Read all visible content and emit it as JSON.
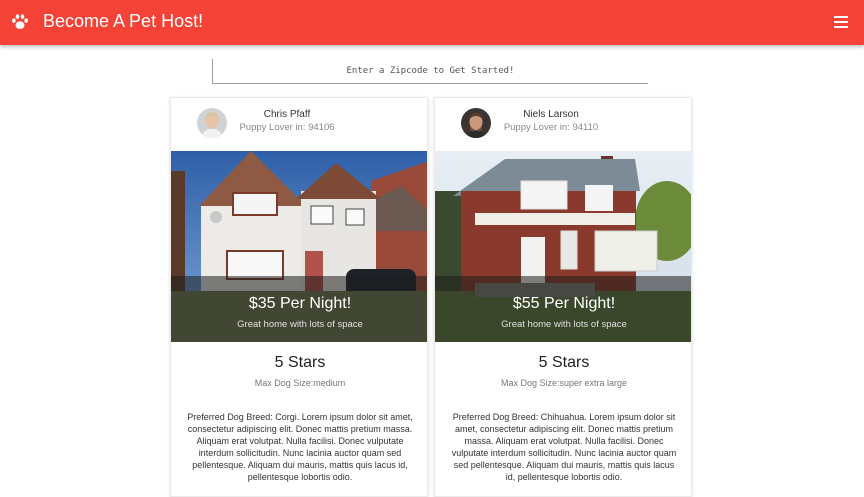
{
  "app": {
    "title": "Become A Pet Host!",
    "brand_color": "#f44336",
    "logo_icon": "paw-icon",
    "menu_icon": "hamburger-menu-icon"
  },
  "search": {
    "placeholder": "Enter a Zipcode to Get Started!",
    "value": ""
  },
  "listings": [
    {
      "host_name": "Chris Pfaff",
      "host_zip": "Puppy Lover in: 94106",
      "price": "$35 Per Night!",
      "tagline": "Great home with lots of space",
      "rating": "5 Stars",
      "max_dog_size": "Max Dog Size:medium",
      "description": "Preferred Dog Breed: Corgi. Lorem ipsum dolor sit amet, consectetur adipiscing elit. Donec mattis pretium massa. Aliquam erat volutpat. Nulla facilisi. Donec vulputate interdum sollicitudin. Nunc lacinia auctor quam sed pellentesque. Aliquam dui mauris, mattis quis lacus id, pellentesque lobortis odio."
    },
    {
      "host_name": "Niels Larson",
      "host_zip": "Puppy Lover in: 94110",
      "price": "$55 Per Night!",
      "tagline": "Great home with lots of space",
      "rating": "5 Stars",
      "max_dog_size": "Max Dog Size:super extra large",
      "description": "Preferred Dog Breed: Chihuahua. Lorem ipsum dolor sit amet, consectetur adipiscing elit. Donec mattis pretium massa. Aliquam erat volutpat. Nulla facilisi. Donec vulputate interdum sollicitudin. Nunc lacinia auctor quam sed pellentesque. Aliquam dui mauris, mattis quis lacus id, pellentesque lobortis odio."
    }
  ]
}
